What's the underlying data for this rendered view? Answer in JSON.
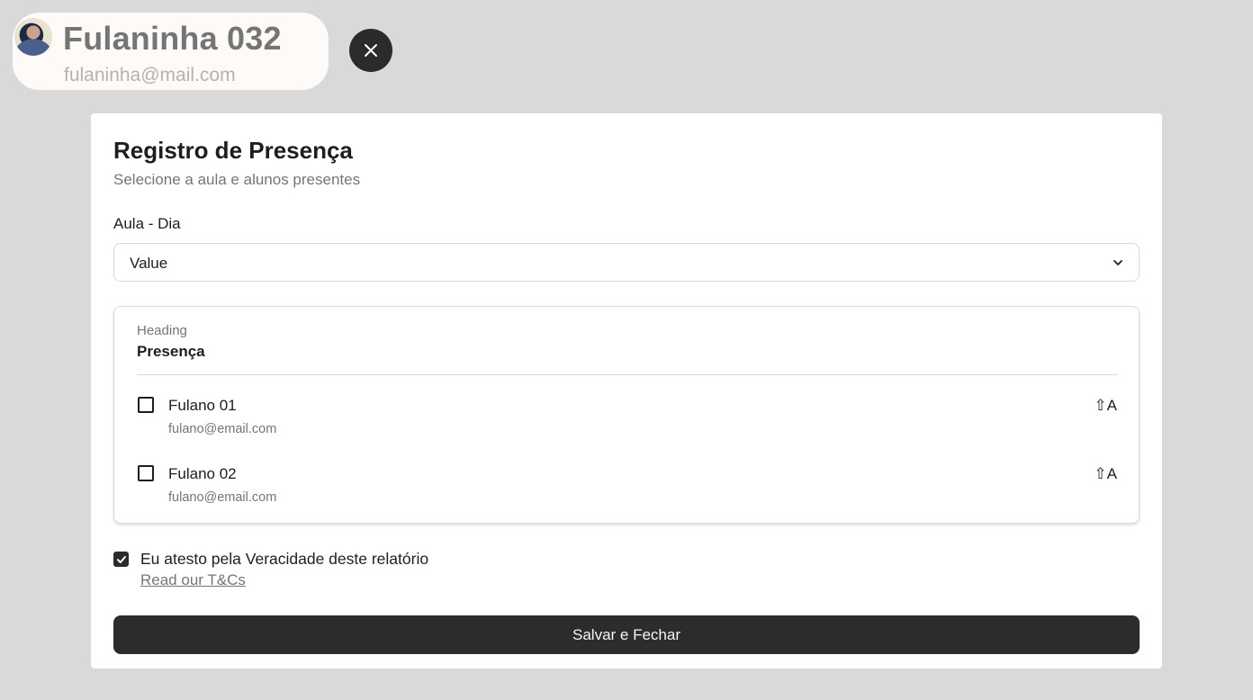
{
  "user": {
    "name": "Fulaninha 032",
    "email": "fulaninha@mail.com",
    "avatar_icon": "user-photo"
  },
  "close_icon": "close-icon",
  "form": {
    "title": "Registro de Presença",
    "subtitle": "Selecione a aula e alunos presentes",
    "field_label": "Aula - Dia",
    "select_value": "Value",
    "list": {
      "heading_small": "Heading",
      "heading": "Presença",
      "students": [
        {
          "name": "Fulano 01",
          "email": "fulano@email.com",
          "shortcut": "⇧A",
          "checked": false
        },
        {
          "name": "Fulano 02",
          "email": "fulano@email.com",
          "shortcut": "⇧A",
          "checked": false
        }
      ]
    },
    "agreement": {
      "label": "Eu atesto pela Veracidade deste relatório",
      "checked": true,
      "link": "Read our T&Cs"
    },
    "submit_label": "Salvar e Fechar"
  },
  "colors": {
    "background": "#d9d9d9",
    "primary": "#2c2c2c",
    "chip": "#fdfaf8"
  }
}
